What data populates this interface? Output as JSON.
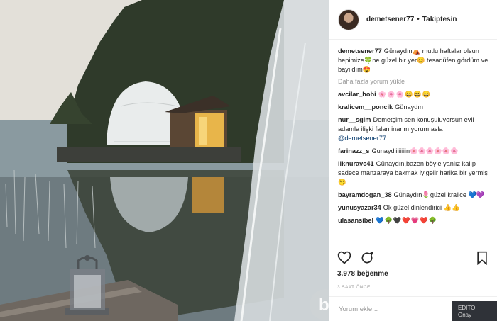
{
  "post": {
    "username": "demetsener77",
    "follow_status": "Takiptesin",
    "caption_user": "demetsener77",
    "caption_text": "Günaydın⛺ mutlu haftalar olsun hepimize🍀ne güzel bir yer😊 tesadüfen gördüm ve bayıldım😍",
    "load_more": "Daha fazla yorum yükle",
    "likes": "3.978 beğenme",
    "time": "3 SAAT ÖNCE",
    "add_comment_placeholder": "Yorum ekle..."
  },
  "comments": [
    {
      "user": "avcilar_hobi",
      "text": "🌸🌸🌸😀😀😀"
    },
    {
      "user": "kralicem__poncik",
      "text": "Günaydın"
    },
    {
      "user": "nur__sglm",
      "text": "Demetçim sen konuşuluyorsun evli adamla ilişki falan inanmıyorum asla",
      "mention": "@demetsener77"
    },
    {
      "user": "farinazz_s",
      "text": "Gunaydiiiiiiiin🌸🌸🌸🌸🌸🌸"
    },
    {
      "user": "ilknuravc41",
      "text": "Günaydın,bazen böyle yanlız kalıp sadece manzaraya bakmak iyigelir harika bir yermiş😏"
    },
    {
      "user": "bayramdogan_38",
      "text": "Günaydın🌷güzel kralice 💙💜"
    },
    {
      "user": "yunusyazar34",
      "text": "Ok güzel dinlendirici 👍👍"
    },
    {
      "user": "ulasansibel",
      "text": "💙🌳🖤❤️💗❤️🌳"
    }
  ],
  "icons": [
    "heart-icon",
    "comment-icon",
    "bookmark-icon",
    "avatar"
  ],
  "badge": {
    "line1": "EDITO",
    "line2": "Onay"
  },
  "colors": {
    "link": "#003569",
    "muted": "#999999",
    "text": "#262626"
  }
}
